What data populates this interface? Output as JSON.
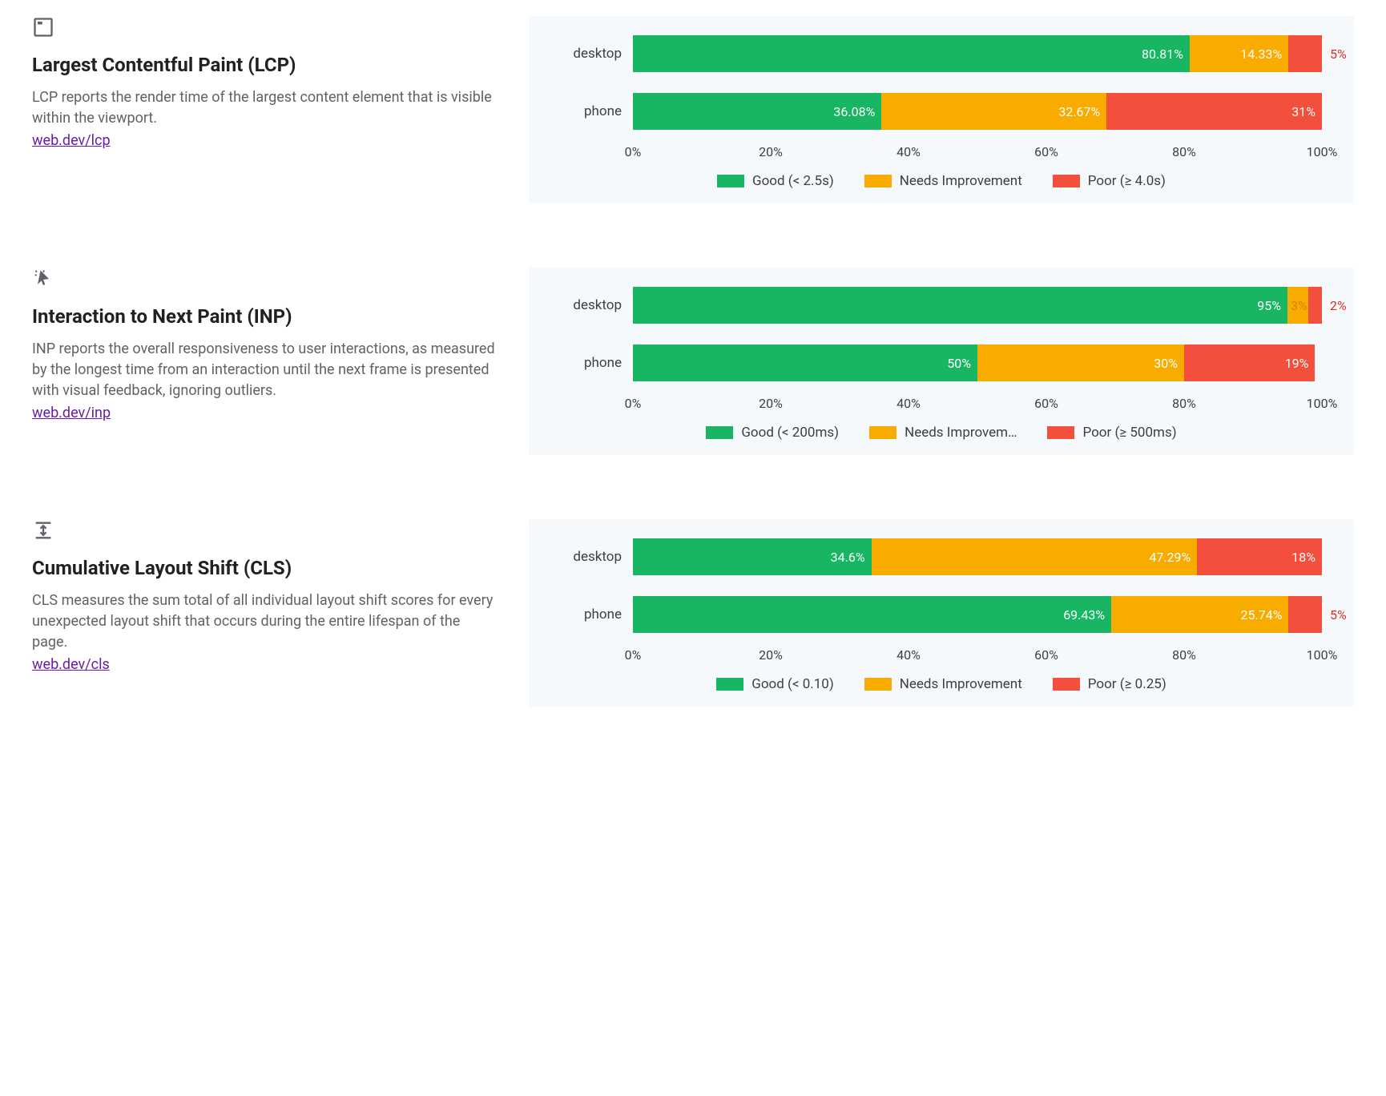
{
  "axis_ticks": [
    "0%",
    "20%",
    "40%",
    "60%",
    "80%",
    "100%"
  ],
  "colors": {
    "good": "#18b663",
    "needs": "#faab00",
    "poor": "#f2503d",
    "link": "#681da8"
  },
  "metrics": [
    {
      "key": "lcp",
      "title": "Largest Contentful Paint (LCP)",
      "description": "LCP reports the render time of the largest content element that is visible within the viewport.",
      "link_text": "web.dev/lcp",
      "legend": {
        "good": "Good (< 2.5s)",
        "needs": "Needs Improvement",
        "poor": "Poor (≥ 4.0s)"
      },
      "rows": [
        {
          "label": "desktop",
          "good": {
            "v": 80.81,
            "t": "80.81%"
          },
          "needs": {
            "v": 14.33,
            "t": "14.33%"
          },
          "poor": {
            "v": 4.86,
            "t": "5%",
            "overflow": true
          }
        },
        {
          "label": "phone",
          "good": {
            "v": 36.08,
            "t": "36.08%"
          },
          "needs": {
            "v": 32.67,
            "t": "32.67%"
          },
          "poor": {
            "v": 31.25,
            "t": "31%"
          }
        }
      ]
    },
    {
      "key": "inp",
      "title": "Interaction to Next Paint (INP)",
      "description": "INP reports the overall responsiveness to user interactions, as measured by the longest time from an interaction until the next frame is presented with visual feedback, ignoring outliers.",
      "link_text": "web.dev/inp",
      "legend": {
        "good": "Good (< 200ms)",
        "needs": "Needs Improvem…",
        "poor": "Poor (≥ 500ms)"
      },
      "rows": [
        {
          "label": "desktop",
          "good": {
            "v": 95,
            "t": "95%"
          },
          "needs": {
            "v": 3,
            "t": "3%",
            "small": true
          },
          "poor": {
            "v": 2,
            "t": "2%",
            "overflow": true
          }
        },
        {
          "label": "phone",
          "good": {
            "v": 50,
            "t": "50%"
          },
          "needs": {
            "v": 30,
            "t": "30%"
          },
          "poor": {
            "v": 19,
            "t": "19%"
          }
        }
      ]
    },
    {
      "key": "cls",
      "title": "Cumulative Layout Shift (CLS)",
      "description": "CLS measures the sum total of all individual layout shift scores for every unexpected layout shift that occurs during the entire lifespan of the page.",
      "link_text": "web.dev/cls",
      "legend": {
        "good": "Good (< 0.10)",
        "needs": "Needs Improvement",
        "poor": "Poor (≥ 0.25)"
      },
      "rows": [
        {
          "label": "desktop",
          "good": {
            "v": 34.6,
            "t": "34.6%"
          },
          "needs": {
            "v": 47.29,
            "t": "47.29%"
          },
          "poor": {
            "v": 18.11,
            "t": "18%"
          }
        },
        {
          "label": "phone",
          "good": {
            "v": 69.43,
            "t": "69.43%"
          },
          "needs": {
            "v": 25.74,
            "t": "25.74%"
          },
          "poor": {
            "v": 4.83,
            "t": "5%",
            "overflow": true
          }
        }
      ]
    }
  ],
  "chart_data": [
    {
      "type": "bar",
      "layout": "stacked-horizontal",
      "title": "Largest Contentful Paint (LCP)",
      "categories": [
        "desktop",
        "phone"
      ],
      "xlabel": "",
      "ylabel": "",
      "ylim": [
        0,
        100
      ],
      "series": [
        {
          "name": "Good (< 2.5s)",
          "values": [
            80.81,
            36.08
          ]
        },
        {
          "name": "Needs Improvement",
          "values": [
            14.33,
            32.67
          ]
        },
        {
          "name": "Poor (≥ 4.0s)",
          "values": [
            4.86,
            31.25
          ]
        }
      ]
    },
    {
      "type": "bar",
      "layout": "stacked-horizontal",
      "title": "Interaction to Next Paint (INP)",
      "categories": [
        "desktop",
        "phone"
      ],
      "xlabel": "",
      "ylabel": "",
      "ylim": [
        0,
        100
      ],
      "series": [
        {
          "name": "Good (< 200ms)",
          "values": [
            95,
            50
          ]
        },
        {
          "name": "Needs Improvement",
          "values": [
            3,
            30
          ]
        },
        {
          "name": "Poor (≥ 500ms)",
          "values": [
            2,
            19
          ]
        }
      ]
    },
    {
      "type": "bar",
      "layout": "stacked-horizontal",
      "title": "Cumulative Layout Shift (CLS)",
      "categories": [
        "desktop",
        "phone"
      ],
      "xlabel": "",
      "ylabel": "",
      "ylim": [
        0,
        100
      ],
      "series": [
        {
          "name": "Good (< 0.10)",
          "values": [
            34.6,
            69.43
          ]
        },
        {
          "name": "Needs Improvement",
          "values": [
            47.29,
            25.74
          ]
        },
        {
          "name": "Poor (≥ 0.25)",
          "values": [
            18.11,
            4.83
          ]
        }
      ]
    }
  ]
}
